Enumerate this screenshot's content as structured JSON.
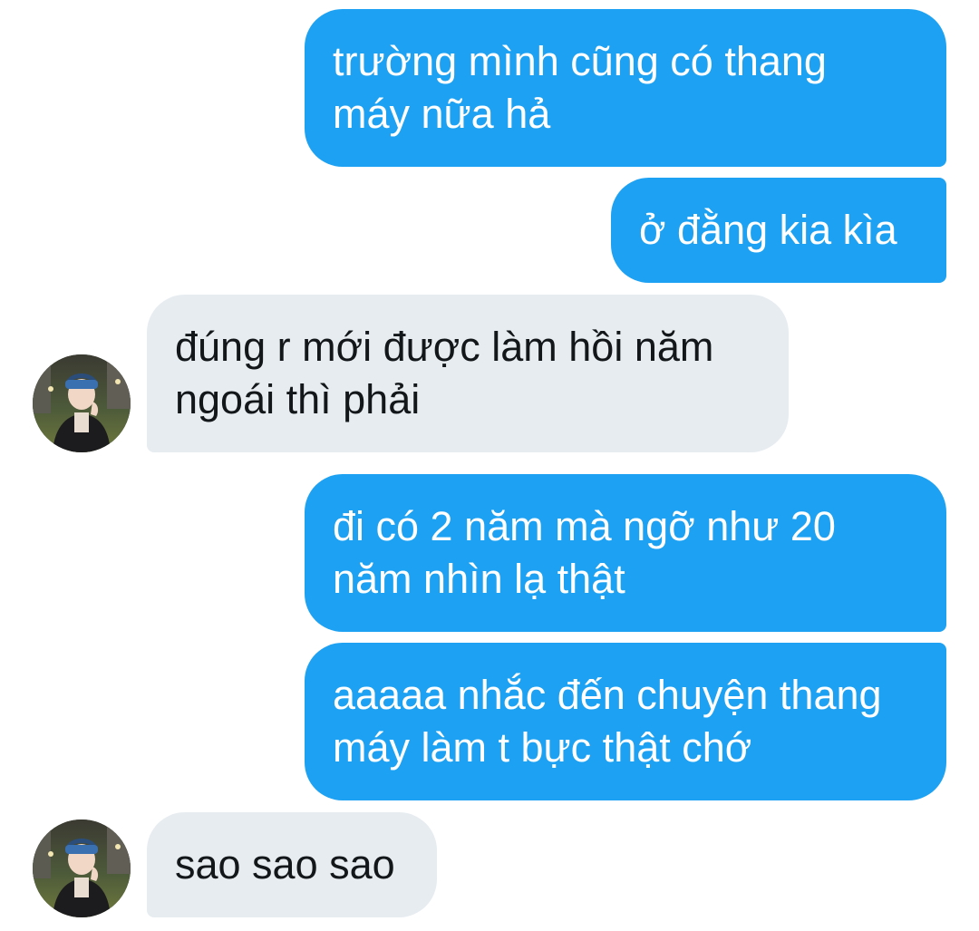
{
  "messages": [
    {
      "sender": "me",
      "lines": [
        "trường mình cũng có thang",
        "máy nữa hả"
      ]
    },
    {
      "sender": "me",
      "lines": [
        "ở đằng kia kìa"
      ]
    },
    {
      "sender": "other",
      "lines": [
        "đúng r mới được làm hồi năm",
        "ngoái thì phải"
      ]
    },
    {
      "sender": "me",
      "lines": [
        "đi có 2 năm mà ngỡ như 20",
        "năm nhìn lạ thật"
      ]
    },
    {
      "sender": "me",
      "lines": [
        "aaaaa nhắc đến chuyện thang",
        "máy làm t bực thật chớ"
      ]
    },
    {
      "sender": "other",
      "lines": [
        "sao sao sao"
      ]
    }
  ],
  "colors": {
    "outgoing_bubble": "#1da1f2",
    "incoming_bubble": "#e6ecf0",
    "outgoing_text": "#ffffff",
    "incoming_text": "#14171a"
  },
  "avatar": {
    "icon": "user-avatar-photo"
  }
}
